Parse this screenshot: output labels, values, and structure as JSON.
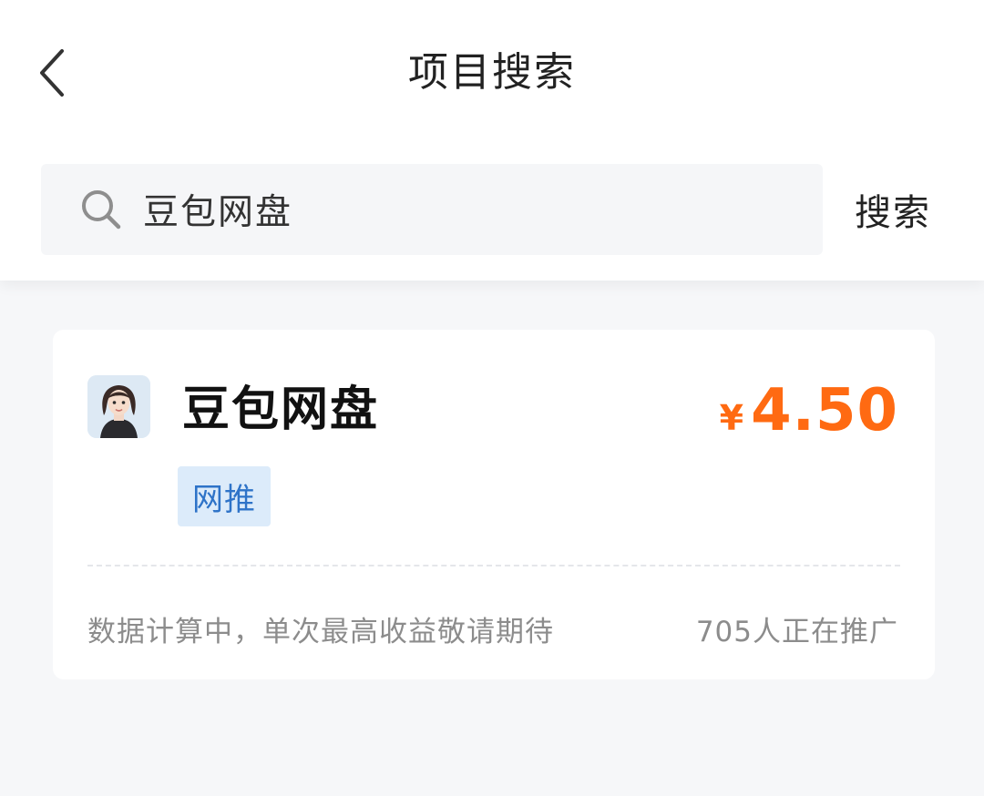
{
  "header": {
    "title": "项目搜索",
    "back_icon": "chevron-left-icon"
  },
  "search": {
    "value": "豆包网盘",
    "icon": "search-icon",
    "button_label": "搜索"
  },
  "result": {
    "title": "豆包网盘",
    "price_currency": "¥",
    "price_value": "4.50",
    "tag": "网推",
    "status_text": "数据计算中，单次最高收益敬请期待",
    "promoters_text": "705人正在推广",
    "avatar_icon": "avatar-icon"
  },
  "colors": {
    "price": "#ff6a12",
    "tag_bg": "#dcebfa",
    "tag_text": "#2e73c8",
    "page_bg": "#f6f7f9"
  }
}
